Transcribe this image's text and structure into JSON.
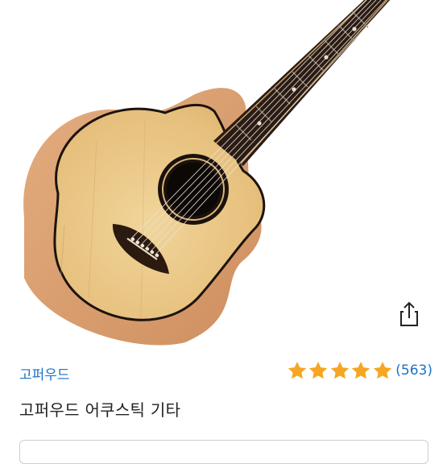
{
  "product": {
    "brand": "고퍼우드",
    "title": "고퍼우드 어쿠스틱 기타",
    "rating": 5,
    "rating_max": 5,
    "review_count": "(563)"
  },
  "icons": {
    "share": "share-icon",
    "star": "star-icon"
  },
  "colors": {
    "star": "#f5a623",
    "link": "#1a73c8"
  }
}
